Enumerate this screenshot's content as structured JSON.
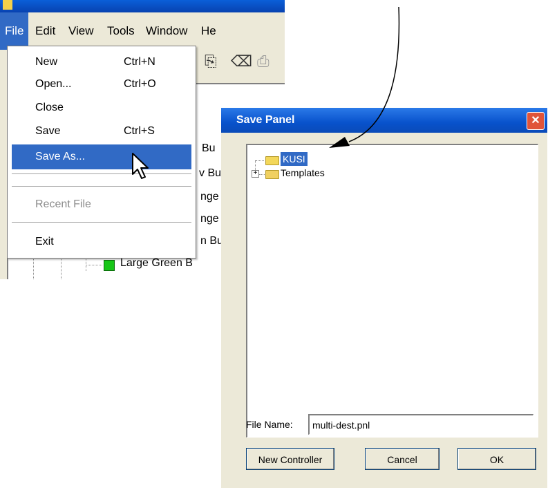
{
  "app": {
    "title": "",
    "menus": [
      "File",
      "Edit",
      "View",
      "Tools",
      "Window",
      "He"
    ],
    "toolbar_icons": [
      "copy-icon",
      "lock-icon",
      "print-icon"
    ],
    "tree_fragments": [
      "Bu",
      "v Bu",
      "nge",
      "nge",
      "n Bu"
    ],
    "tree_item": "Large Green B"
  },
  "file_menu": {
    "items": [
      {
        "label": "New",
        "shortcut": "Ctrl+N"
      },
      {
        "label": "Open...",
        "shortcut": "Ctrl+O"
      },
      {
        "label": "Close",
        "shortcut": ""
      },
      {
        "label": "Save",
        "shortcut": "Ctrl+S"
      },
      {
        "label": "Save As...",
        "shortcut": ""
      },
      {
        "label": "Recent File",
        "shortcut": ""
      },
      {
        "label": "Exit",
        "shortcut": ""
      }
    ]
  },
  "dialog": {
    "title": "Save Panel",
    "close": "✕",
    "tree": [
      {
        "label": "KUSI",
        "selected": true
      },
      {
        "label": "Templates",
        "selected": false
      }
    ],
    "expand": "+",
    "filename_label": "File Name:",
    "filename_value": "multi-dest.pnl",
    "buttons": {
      "new": "New Controller",
      "cancel": "Cancel",
      "ok": "OK"
    }
  },
  "colors": {
    "highlight": "#316ac5",
    "titlebar": "#0852cc",
    "close": "#e0543a"
  }
}
